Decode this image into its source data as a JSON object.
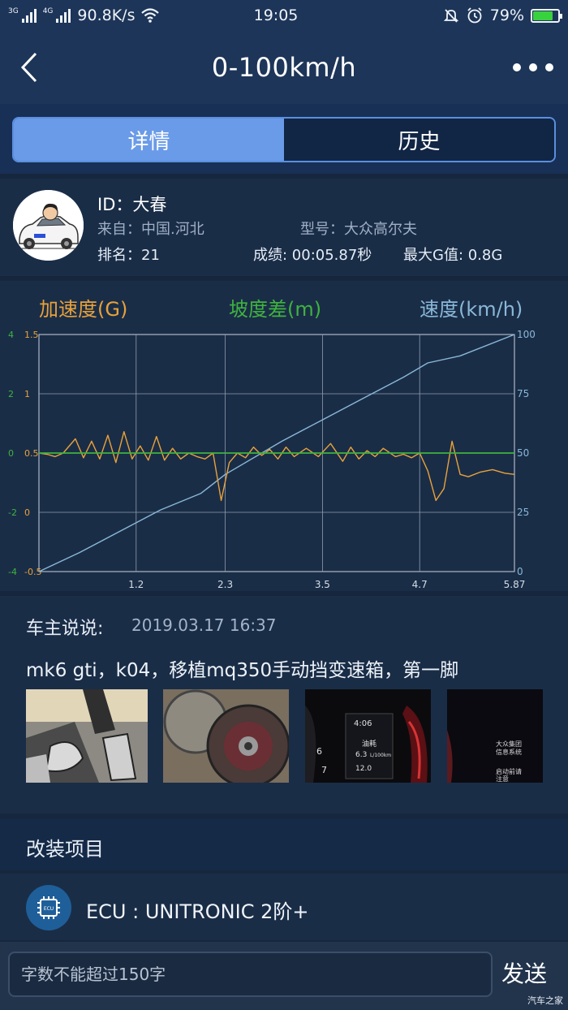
{
  "status_bar": {
    "net_left": "3G",
    "net_right": "4G",
    "speed": "90.8K/s",
    "time": "19:05",
    "battery": "79%",
    "battery_level": 0.79
  },
  "header": {
    "title": "0-100km/h"
  },
  "tabs": [
    {
      "label": "详情",
      "active": true
    },
    {
      "label": "历史",
      "active": false
    }
  ],
  "profile": {
    "id_line": "ID：大春",
    "from": "来自：中国.河北",
    "model": "型号：大众高尔夫",
    "rank": "排名：21",
    "score": "成绩: 00:05.87秒",
    "max_g": "最大G值: 0.8G"
  },
  "chart_data": {
    "type": "line",
    "legend": [
      "加速度(G)",
      "坡度差(m)",
      "速度(km/h)"
    ],
    "colors": {
      "accel": "#e8a23a",
      "slope": "#3fb33f",
      "speed": "#8ab8d8"
    },
    "x_ticks": [
      "1.2",
      "2.3",
      "3.5",
      "4.7",
      "5.87"
    ],
    "xlim": [
      0,
      5.87
    ],
    "y_left_outer_ticks": [
      "4",
      "2",
      "0",
      "-2",
      "-4"
    ],
    "y_left_inner_ticks": [
      "1.5",
      "1",
      "0.5",
      "0",
      "-0.5"
    ],
    "y_right_ticks": [
      "100",
      "75",
      "50",
      "25",
      "0"
    ],
    "ylim_accel": [
      -0.5,
      1.5
    ],
    "ylim_slope": [
      -4,
      4
    ],
    "ylim_speed": [
      0,
      100
    ],
    "speed": {
      "x": [
        0,
        0.5,
        1.0,
        1.5,
        2.0,
        2.3,
        3.0,
        3.5,
        4.0,
        4.5,
        4.8,
        5.2,
        5.87
      ],
      "y": [
        0,
        8,
        17,
        26,
        33,
        41,
        55,
        64,
        73,
        82,
        88,
        91,
        100
      ]
    },
    "slope": {
      "x": [
        0,
        1,
        2,
        3,
        4,
        5,
        5.87
      ],
      "y": [
        0,
        0,
        0,
        0,
        0,
        0,
        0
      ]
    },
    "accel": {
      "x": [
        0,
        0.1,
        0.2,
        0.3,
        0.45,
        0.55,
        0.65,
        0.75,
        0.85,
        0.95,
        1.05,
        1.15,
        1.25,
        1.35,
        1.45,
        1.55,
        1.65,
        1.75,
        1.85,
        1.95,
        2.05,
        2.15,
        2.25,
        2.35,
        2.45,
        2.55,
        2.65,
        2.75,
        2.85,
        2.95,
        3.05,
        3.15,
        3.3,
        3.45,
        3.6,
        3.75,
        3.85,
        3.95,
        4.05,
        4.15,
        4.25,
        4.4,
        4.5,
        4.6,
        4.7,
        4.8,
        4.9,
        5.0,
        5.1,
        5.2,
        5.3,
        5.45,
        5.6,
        5.75,
        5.87
      ],
      "y": [
        0.5,
        0.49,
        0.47,
        0.5,
        0.62,
        0.46,
        0.6,
        0.45,
        0.65,
        0.42,
        0.68,
        0.45,
        0.56,
        0.44,
        0.64,
        0.44,
        0.54,
        0.45,
        0.5,
        0.47,
        0.45,
        0.5,
        0.1,
        0.42,
        0.5,
        0.46,
        0.55,
        0.48,
        0.53,
        0.45,
        0.55,
        0.47,
        0.54,
        0.47,
        0.58,
        0.43,
        0.55,
        0.45,
        0.52,
        0.47,
        0.54,
        0.47,
        0.49,
        0.46,
        0.5,
        0.35,
        0.1,
        0.2,
        0.6,
        0.32,
        0.3,
        0.34,
        0.36,
        0.33,
        0.32
      ]
    }
  },
  "comment": {
    "heading": "车主说说:",
    "date": "2019.03.17 16:37",
    "text": "mk6 gti，k04，移植mq350手动挡变速箱，第一脚",
    "photos": [
      "pedals-photo",
      "clutch-photo",
      "dashboard-photo",
      "screen-photo"
    ],
    "dash_time": "4:06",
    "dash_label": "油耗",
    "dash_value": "6.3",
    "dash_unit": "L/100km",
    "dash_value2": "12.0",
    "dash_num_a": "6",
    "dash_num_b": "7",
    "screen_line1": "大众集团",
    "screen_line2": "信息系统",
    "screen_line3": "启动前请",
    "screen_line4": "注意"
  },
  "mods": {
    "title": "改装项目",
    "items": [
      {
        "label": "ECU : UNITRONIC 2阶+",
        "icon": "chip-icon",
        "chip_text": "ECU"
      }
    ]
  },
  "input_bar": {
    "placeholder": "字数不能超过150字",
    "send_label": "发送",
    "watermark": "汽车之家"
  }
}
